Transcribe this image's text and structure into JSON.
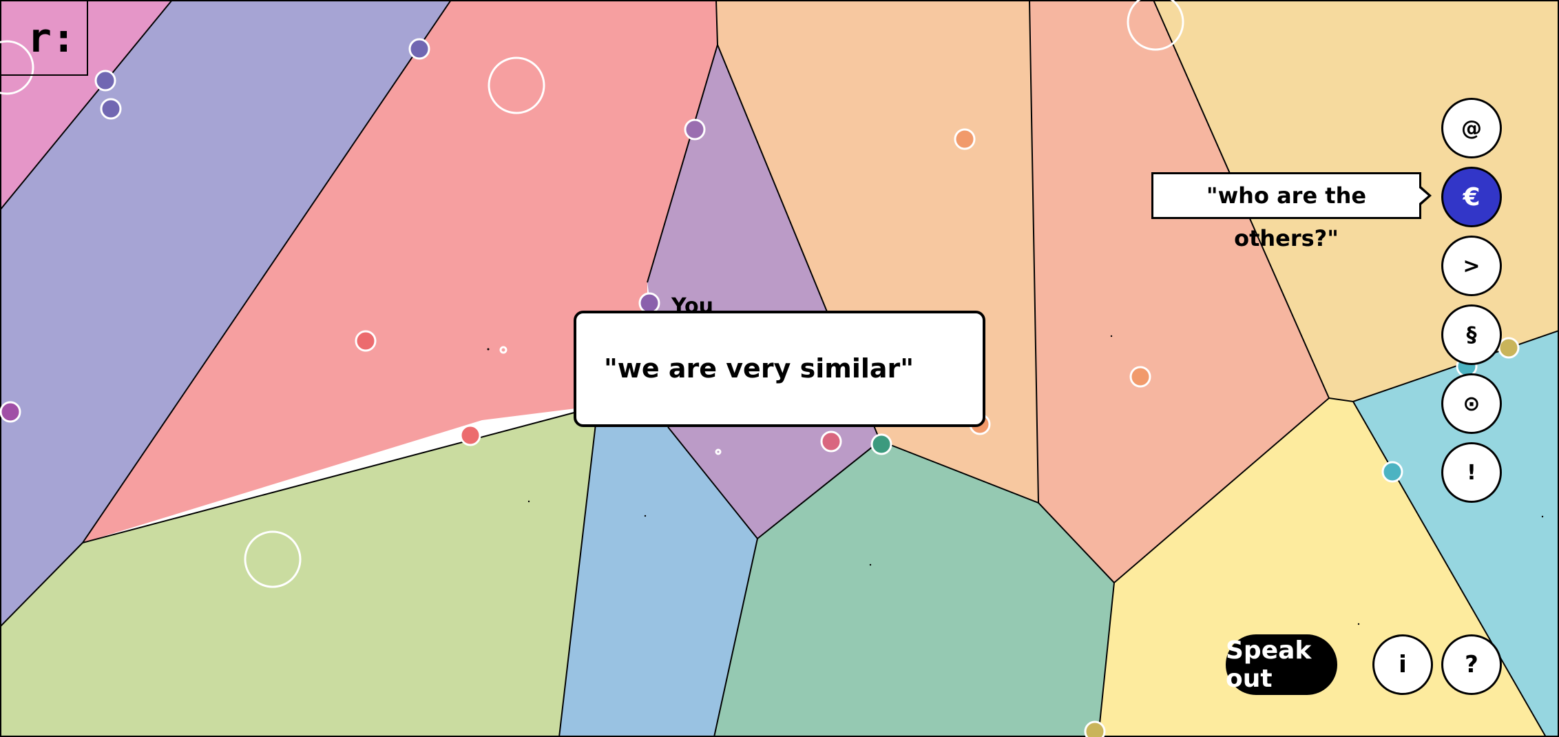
{
  "app": {
    "logo_text": "r:"
  },
  "canvas": {
    "you_label": "You",
    "cell_colors": [
      "#e596c8",
      "#a6a4d4",
      "#f69fa0",
      "#bb9bc7",
      "#f7c8a0",
      "#f6b6a0",
      "#f6da9e",
      "#cadca0",
      "#99c2e2",
      "#95c9b2",
      "#fdeb9e",
      "#96d6e0"
    ]
  },
  "speech_bubble": {
    "text": "\"we are very similar\""
  },
  "toolbar": {
    "buttons": [
      {
        "label": "@",
        "icon": "at-icon",
        "active": false
      },
      {
        "label": "€",
        "icon": "euro-icon",
        "active": true
      },
      {
        "label": ">",
        "icon": "greater-than-icon",
        "active": false
      },
      {
        "label": "§",
        "icon": "section-icon",
        "active": false
      },
      {
        "label": "⊙",
        "icon": "circled-dot-icon",
        "active": false
      },
      {
        "label": "!",
        "icon": "exclamation-icon",
        "active": false
      }
    ],
    "active_tooltip": "\"who are the others?\"",
    "active_color": "#3236c8"
  },
  "bottom_bar": {
    "speak_out_label": "Speak out",
    "info_label": "i",
    "help_label": "?"
  }
}
